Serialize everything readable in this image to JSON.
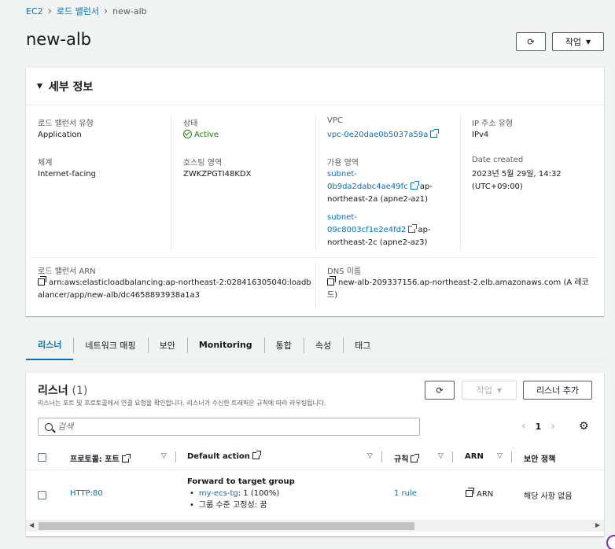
{
  "breadcrumb": {
    "ec2": "EC2",
    "load_balancers": "로드 밸런서",
    "current": "new-alb"
  },
  "page_title": "new-alb",
  "header_buttons": {
    "action": "작업"
  },
  "details": {
    "title": "세부 정보",
    "lb_type_label": "로드 밸런서 유형",
    "lb_type_value": "Application",
    "status_label": "상태",
    "status_value": "Active",
    "vpc_label": "VPC",
    "vpc_value": "vpc-0e20dae0b5037a59a",
    "ip_type_label": "IP 주소 유형",
    "ip_type_value": "IPv4",
    "scheme_label": "체계",
    "scheme_value": "Internet-facing",
    "hosted_zone_label": "호스팅 영역",
    "hosted_zone_value": "ZWKZPGTI48KDX",
    "az_label": "가용 영역",
    "az1_subnet_a": "subnet-",
    "az1_subnet_b": "0b9da2dabc4ae49fc",
    "az1_zone_a": "ap-",
    "az1_zone_b": "northeast-2a (apne2-az1)",
    "az2_subnet_a": "subnet-",
    "az2_subnet_b": "09c8003cf1e2e4fd2",
    "az2_zone_a": "ap-",
    "az2_zone_b": "northeast-2c (apne2-az3)",
    "date_label": "Date created",
    "date_value_a": "2023년 5월 29일, 14:32",
    "date_value_b": "(UTC+09:00)",
    "arn_label": "로드 밸런서 ARN",
    "arn_value_a": "arn:aws:elasticloadbalancing:ap-northeast-2:028416305040:loadb",
    "arn_value_b": "alancer/app/new-alb/dc4658893938a1a3",
    "dns_label": "DNS 이름",
    "dns_value_a": "new-alb-209337156.ap-northeast-2.elb.amazonaws.com (A 레코",
    "dns_value_b": "드)"
  },
  "tabs": [
    "리스너",
    "네트워크 매핑",
    "보안",
    "Monitoring",
    "통합",
    "속성",
    "태그"
  ],
  "listeners": {
    "title": "리스너",
    "count": "(1)",
    "description": "리스너는 포트 및 프로토콜에서 연결 요청을 확인합니다. 리스너가 수신한 트래픽은 규칙에 따라 라우팅됩니다.",
    "action_button": "작업",
    "add_button": "리스너 추가",
    "search_placeholder": "검색",
    "page": "1",
    "columns": {
      "protocol": "프로토콜: 포트",
      "default_action": "Default action",
      "rules": "규칙",
      "arn": "ARN",
      "security_policy": "보안 정책"
    },
    "rows": [
      {
        "protocol": "HTTP:80",
        "action_title": "Forward to target group",
        "target_group": "my-ecs-tg",
        "target_weight": ": 1 (100%)",
        "stickiness": "그룹 수준 고정성: 꿈",
        "rules": "1 rule",
        "arn": "ARN",
        "security_policy": "해당 사항 없음"
      }
    ]
  }
}
